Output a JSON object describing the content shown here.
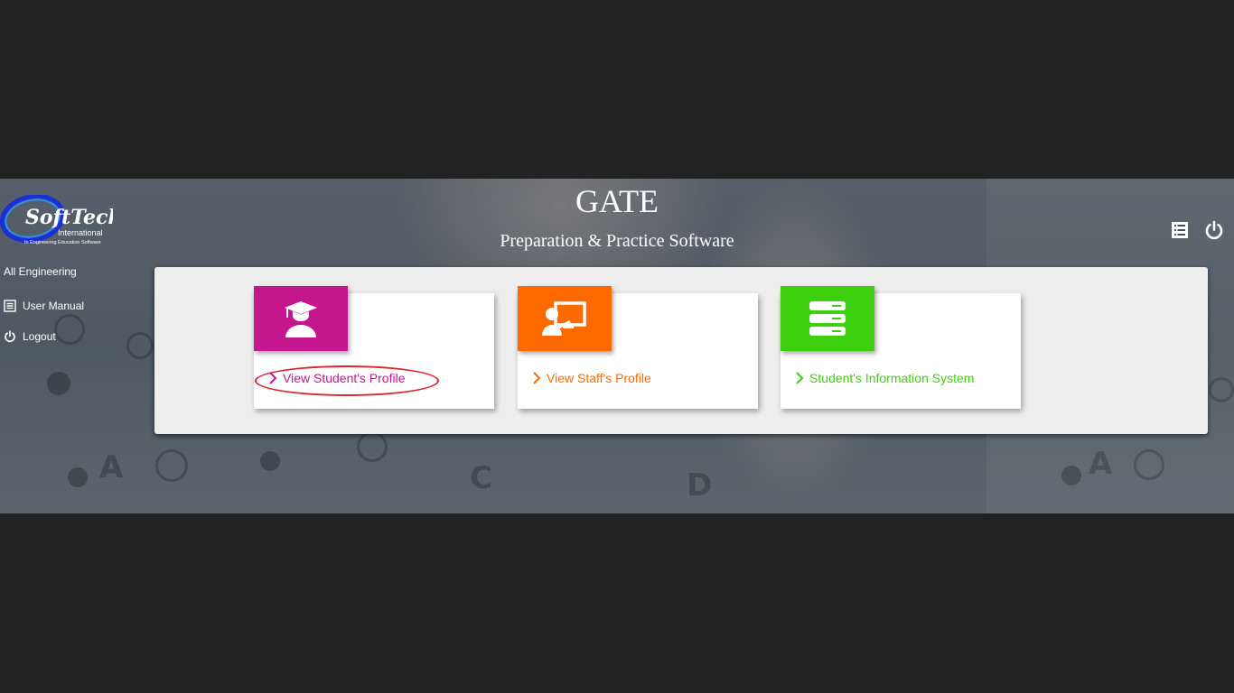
{
  "app": {
    "title": "GATE",
    "subtitle": "Preparation & Practice Software"
  },
  "logo": {
    "brand_line1": "SoftTech",
    "brand_line2": "International",
    "tagline": "In Engineering Education Software"
  },
  "sidebar": {
    "category_label": "All Engineering",
    "items": [
      {
        "label": "User Manual",
        "icon": "list-icon"
      },
      {
        "label": "Logout",
        "icon": "power-icon"
      }
    ]
  },
  "header_actions": [
    {
      "icon": "list-icon"
    },
    {
      "icon": "power-icon"
    }
  ],
  "cards": [
    {
      "label": "View Student's Profile",
      "icon": "student-graduate-icon",
      "color": "#c4168d"
    },
    {
      "label": "View Staff's Profile",
      "icon": "teacher-board-icon",
      "color": "#ff6a00"
    },
    {
      "label": "Student's Information System",
      "icon": "server-stack-icon",
      "color": "#3ecf0e"
    }
  ],
  "colors": {
    "screen_background": "#222222",
    "panel_background": "#eeeeee",
    "highlight_circle": "#d9262e"
  }
}
